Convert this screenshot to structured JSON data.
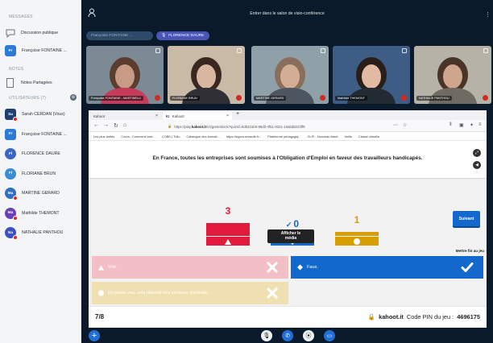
{
  "sidebar": {
    "messages_label": "MESSAGES",
    "public_chat": "Discussion publique",
    "private_chat": {
      "initials": "Fr",
      "name": "Françoise FONTAINE ..."
    },
    "notes_label": "NOTES",
    "shared_notes": "Notes Partagées",
    "users_label": "UTILISATEURS (7)",
    "users": [
      {
        "initials": "Sa",
        "name": "Sarah CERDAN (Vous)",
        "color": "#1e3f70",
        "square": true,
        "presenter": true
      },
      {
        "initials": "Fr",
        "name": "Françoise FONTAINE ...",
        "color": "#2b7bd6",
        "square": true,
        "presenter": false
      },
      {
        "initials": "Fl",
        "name": "FLORENCE DAURE",
        "color": "#3a64c8",
        "square": false,
        "presenter": false
      },
      {
        "initials": "Fl",
        "name": "FLORIANE BRUN",
        "color": "#3a8bd6",
        "square": false,
        "presenter": false
      },
      {
        "initials": "Ma",
        "name": "MARTINE GERARD",
        "color": "#2f6fc4",
        "square": false,
        "presenter": true
      },
      {
        "initials": "Ma",
        "name": "Mathilde THEMONT",
        "color": "#6a3fb8",
        "square": false,
        "presenter": true
      },
      {
        "initials": "Na",
        "name": "NATHALIE PANTHOU",
        "color": "#3a4fc0",
        "square": false,
        "presenter": true
      }
    ]
  },
  "topbar": {
    "room_title": "Entrer dans le salon de visio-conférence",
    "chip_1": "Françoise FONTAINE ...",
    "chip_2": "FLORENCE DAURE"
  },
  "videos": [
    {
      "name": "Françoise FONTAINE - MARTINELLI",
      "bg": "#7b8a94",
      "skin": "#c99a86",
      "hair": "#5a3d2e",
      "shirt": "#c63b5a"
    },
    {
      "name": "FLORIANE BRUN",
      "bg": "#c9b9a7",
      "skin": "#d9b6a0",
      "hair": "#3a2820",
      "shirt": "#2f2f35"
    },
    {
      "name": "MARTINE GERARD",
      "bg": "#8fa0a8",
      "skin": "#d4ad96",
      "hair": "#8a6e5c",
      "shirt": "#4d5660"
    },
    {
      "name": "Mathilde THEMONT",
      "bg": "#3d5c86",
      "skin": "#e2b9a2",
      "hair": "#2a1e18",
      "shirt": "#222a33"
    },
    {
      "name": "NATHALIE PANTHOU",
      "bg": "#b7b2a8",
      "skin": "#cfa58e",
      "hair": "#4a3428",
      "shirt": "#6f6a62"
    }
  ],
  "browser": {
    "tab_1": "Kahoot",
    "tab_2": "Kahoot!",
    "url_host": "https://play.",
    "url_domain": "kahoot.it",
    "url_rest": "/v2/gameblock?quizId=6d542de5-89d3-4f51-9321-16abd8223ff8",
    "bookmarks": [
      "Les plus visités",
      "Cours : Comment crée...",
      "COBD | Tuilo",
      "Catalogue des formati...",
      "https://sigora.enasofs.fr...",
      "Plateforme pédagogiq...",
      "GLPI - Nouveau ticket",
      "Veille",
      "Classe virtuelle"
    ]
  },
  "kahoot": {
    "question": "En France, toutes les entreprises sont soumises à l'Obligation d'Emploi en faveur des travailleurs handicapés.",
    "skip_label": "Suivant",
    "media_label_1": "Afficher le",
    "media_label_2": "média",
    "end_label": "Mettre fin au jeu",
    "results": [
      {
        "shape": "triangle",
        "count": "3",
        "color": "#e21b3c",
        "correct": false
      },
      {
        "shape": "diamond",
        "count": "0",
        "color": "#1368ce",
        "correct": true
      },
      {
        "shape": "circle",
        "count": "1",
        "color": "#d89e00",
        "correct": false
      }
    ],
    "answers": [
      {
        "text": "Vrai.",
        "shape": "triangle",
        "correct": false,
        "color": "#f2bfc6"
      },
      {
        "text": "Faux.",
        "shape": "diamond",
        "correct": true,
        "color": "#1368ce"
      },
      {
        "text": "En partie vrai, cela dépend des secteurs d'activité.",
        "shape": "circle",
        "correct": false,
        "color": "#f0dfb0"
      }
    ],
    "progress": "7/8",
    "brand": "kahoot.it",
    "pin_label": "Code PIN du jeu :",
    "pin": "4696175"
  }
}
